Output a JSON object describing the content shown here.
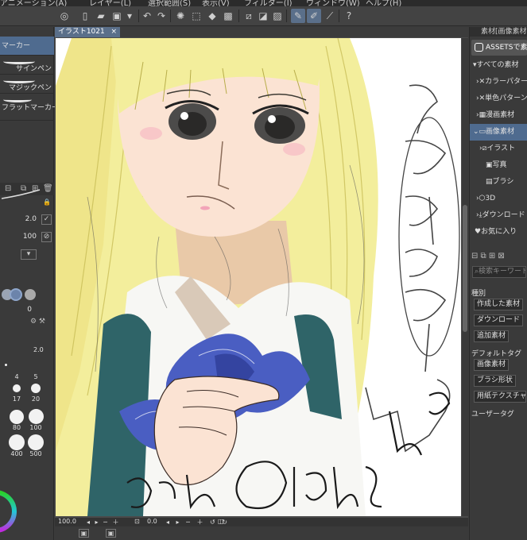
{
  "menubar": {
    "items": [
      "アニメーション(A)",
      "レイヤー(L)",
      "選択範囲(S)",
      "表示(V)",
      "フィルター(I)",
      "ウィンドウ(W)",
      "ヘルプ(H)"
    ]
  },
  "document": {
    "tab_title": "イラスト1021",
    "close_glyph": "×"
  },
  "left_panel": {
    "brushes": [
      {
        "label": "マーカー",
        "selected": true
      },
      {
        "label": "サインペン",
        "selected": false
      },
      {
        "label": "マジックペン",
        "selected": false
      },
      {
        "label": "フラットマーカー",
        "selected": false
      }
    ],
    "brush_size": "2.0",
    "opacity": "100",
    "stabilization": "0",
    "size_palette_value": "2.0",
    "size_palette": [
      "4",
      "5",
      "17",
      "20",
      "80",
      "100",
      "400",
      "500"
    ]
  },
  "status": {
    "zoom": "100.0",
    "angle": "0.0"
  },
  "right_panel": {
    "header_label": "素材[画像素材",
    "assets_button": "ASSETSで素材",
    "tree": [
      {
        "label": "すべての素材",
        "selected": false
      },
      {
        "label": "カラーパターン",
        "selected": false
      },
      {
        "label": "単色パターン",
        "selected": false
      },
      {
        "label": "漫画素材",
        "selected": false
      },
      {
        "label": "画像素材",
        "selected": true
      },
      {
        "label": "イラスト",
        "selected": false
      },
      {
        "label": "写真",
        "selected": false
      },
      {
        "label": "ブラシ",
        "selected": false
      },
      {
        "label": "3D",
        "selected": false
      },
      {
        "label": "ダウンロード",
        "selected": false
      },
      {
        "label": "お気に入り",
        "selected": false
      }
    ],
    "search_placeholder": "検索キーワード",
    "kind_heading": "種別",
    "kind_tags": [
      "作成した素材",
      "ダウンロード",
      "追加素材"
    ],
    "default_tag_heading": "デフォルトタグ",
    "default_tags": [
      "画像素材",
      "ブラシ形状",
      "用紙テクスチャ"
    ],
    "user_tag_heading": "ユーザータグ"
  }
}
